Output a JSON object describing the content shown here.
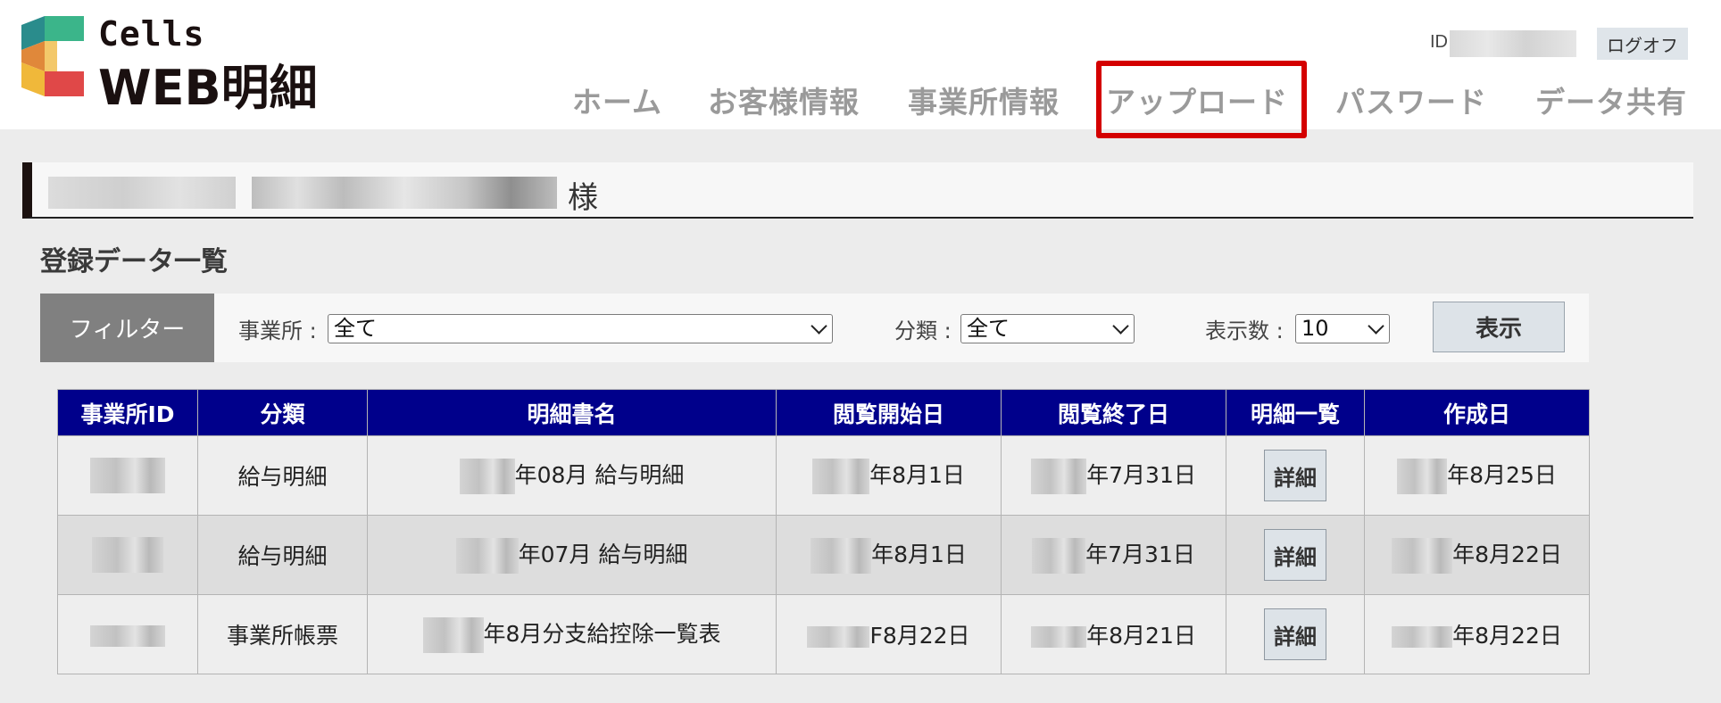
{
  "logo": {
    "small": "Cells",
    "big": "WEB明細"
  },
  "account": {
    "id_label": "ID",
    "logout": "ログオフ"
  },
  "nav": [
    "ホーム",
    "お客様情報",
    "事業所情報",
    "アップロード",
    "パスワード",
    "データ共有"
  ],
  "customer": {
    "suffix": "様"
  },
  "section_title": "登録データ一覧",
  "filter": {
    "tag": "フィルター",
    "office_label": "事業所 :",
    "office_value": "全て",
    "category_label": "分類 :",
    "category_value": "全て",
    "count_label": "表示数 :",
    "count_value": "10",
    "show_button": "表示"
  },
  "table": {
    "headers": [
      "事業所ID",
      "分類",
      "明細書名",
      "閲覧開始日",
      "閲覧終了日",
      "明細一覧",
      "作成日"
    ],
    "rows": [
      {
        "category": "給与明細",
        "name": "年08月 給与明細",
        "start": "年8月1日",
        "end": "年7月31日",
        "detail": "詳細",
        "created": "年8月25日"
      },
      {
        "category": "給与明細",
        "name": "年07月 給与明細",
        "start": "年8月1日",
        "end": "年7月31日",
        "detail": "詳細",
        "created": "年8月22日"
      },
      {
        "category": "事業所帳票",
        "name": "年8月分支給控除一覧表",
        "start": "F8月22日",
        "end": "年8月21日",
        "detail": "詳細",
        "created": "年8月22日"
      }
    ]
  },
  "colors": {
    "header_bg": "#00008b",
    "highlight": "#d40000",
    "nav_text": "#9a9a9a"
  }
}
